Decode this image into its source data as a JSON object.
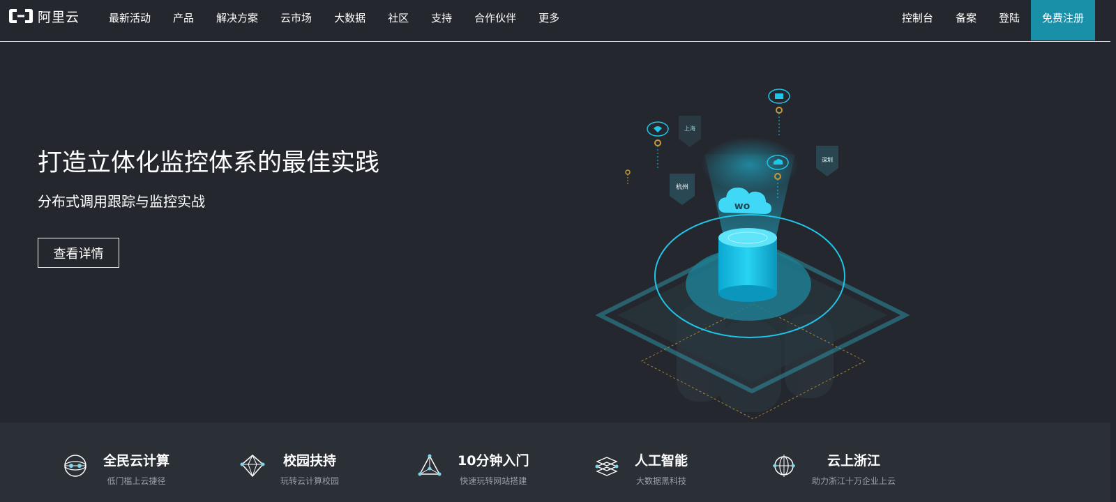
{
  "logo": {
    "text": "阿里云"
  },
  "nav": {
    "items": [
      "最新活动",
      "产品",
      "解决方案",
      "云市场",
      "大数据",
      "社区",
      "支持",
      "合作伙伴",
      "更多"
    ],
    "right": {
      "console": "控制台",
      "filing": "备案",
      "login": "登陆",
      "register": "免费注册"
    }
  },
  "hero": {
    "title": "打造立体化监控体系的最佳实践",
    "subtitle": "分布式调用跟踪与监控实战",
    "button": "查看详情",
    "cities": {
      "shanghai": "上海",
      "hangzhou": "杭州",
      "shenzhen": "深圳"
    },
    "cloud_logo": "wo",
    "colors": {
      "accent": "#1fc6e8",
      "dashed": "#c59a3a"
    }
  },
  "features": [
    {
      "title": "全民云计算",
      "subtitle": "低门槛上云捷径",
      "icon": "globe-network-icon"
    },
    {
      "title": "校园扶持",
      "subtitle": "玩转云计算校园",
      "icon": "diamond-network-icon"
    },
    {
      "title": "10分钟入门",
      "subtitle": "快速玩转网站搭建",
      "icon": "triangle-network-icon"
    },
    {
      "title": "人工智能",
      "subtitle": "大数据黑科技",
      "icon": "layers-network-icon"
    },
    {
      "title": "云上浙江",
      "subtitle": "助力浙江十万企业上云",
      "icon": "orbit-network-icon"
    }
  ]
}
